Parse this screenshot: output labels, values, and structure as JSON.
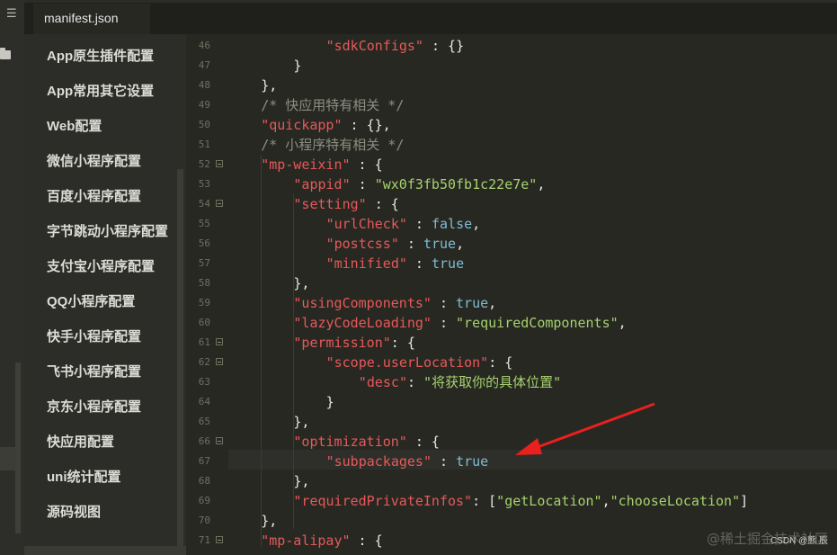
{
  "tab": {
    "label": "manifest.json"
  },
  "sidebar": {
    "items": [
      "App原生插件配置",
      "App常用其它设置",
      "Web配置",
      "微信小程序配置",
      "百度小程序配置",
      "字节跳动小程序配置",
      "支付宝小程序配置",
      "QQ小程序配置",
      "快手小程序配置",
      "飞书小程序配置",
      "京东小程序配置",
      "快应用配置",
      "uni统计配置",
      "源码视图"
    ]
  },
  "editor": {
    "line_numbers": [
      "46",
      "47",
      "48",
      "49",
      "50",
      "51",
      "52",
      "53",
      "54",
      "55",
      "56",
      "57",
      "58",
      "59",
      "60",
      "61",
      "62",
      "63",
      "64",
      "65",
      "66",
      "67",
      "68",
      "69",
      "70",
      "71"
    ],
    "lines": [
      [
        [
          "s",
          "\"sdkConfigs\""
        ],
        [
          "p",
          " : {}"
        ]
      ],
      [
        [
          "p",
          "}"
        ]
      ],
      [
        [
          "p",
          "},"
        ]
      ],
      [
        [
          "c",
          "/* 快应用特有相关 */"
        ]
      ],
      [
        [
          "s",
          "\"quickapp\""
        ],
        [
          "p",
          " : {},"
        ]
      ],
      [
        [
          "c",
          "/* 小程序特有相关 */"
        ]
      ],
      [
        [
          "s",
          "\"mp-weixin\""
        ],
        [
          "p",
          " : {"
        ]
      ],
      [
        [
          "s",
          "\"appid\""
        ],
        [
          "p",
          " : "
        ],
        [
          "t",
          "\"wx0f3fb50fb1c22e7e\""
        ],
        [
          "p",
          ","
        ]
      ],
      [
        [
          "s",
          "\"setting\""
        ],
        [
          "p",
          " : {"
        ]
      ],
      [
        [
          "s",
          "\"urlCheck\""
        ],
        [
          "p",
          " : "
        ],
        [
          "v",
          "false"
        ],
        [
          "p",
          ","
        ]
      ],
      [
        [
          "s",
          "\"postcss\""
        ],
        [
          "p",
          " : "
        ],
        [
          "v",
          "true"
        ],
        [
          "p",
          ","
        ]
      ],
      [
        [
          "s",
          "\"minified\""
        ],
        [
          "p",
          " : "
        ],
        [
          "v",
          "true"
        ]
      ],
      [
        [
          "p",
          "},"
        ]
      ],
      [
        [
          "s",
          "\"usingComponents\""
        ],
        [
          "p",
          " : "
        ],
        [
          "v",
          "true"
        ],
        [
          "p",
          ","
        ]
      ],
      [
        [
          "s",
          "\"lazyCodeLoading\""
        ],
        [
          "p",
          " : "
        ],
        [
          "t",
          "\"requiredComponents\""
        ],
        [
          "p",
          ","
        ]
      ],
      [
        [
          "s",
          "\"permission\""
        ],
        [
          "p",
          ": {"
        ]
      ],
      [
        [
          "s",
          "\"scope.userLocation\""
        ],
        [
          "p",
          ": {"
        ]
      ],
      [
        [
          "s",
          "\"desc\""
        ],
        [
          "p",
          ": "
        ],
        [
          "t",
          "\"将获取你的具体位置\""
        ]
      ],
      [
        [
          "p",
          "}"
        ]
      ],
      [
        [
          "p",
          "},"
        ]
      ],
      [
        [
          "s",
          "\"optimization\""
        ],
        [
          "p",
          " : {"
        ]
      ],
      [
        [
          "s",
          "\"subpackages\""
        ],
        [
          "p",
          " : "
        ],
        [
          "v",
          "true"
        ]
      ],
      [
        [
          "p",
          "},"
        ]
      ],
      [
        [
          "s",
          "\"requiredPrivateInfos\""
        ],
        [
          "p",
          ": ["
        ],
        [
          "t",
          "\"getLocation\""
        ],
        [
          "p",
          ","
        ],
        [
          "t",
          "\"chooseLocation\""
        ],
        [
          "p",
          "]"
        ]
      ],
      [
        [
          "p",
          "},"
        ]
      ],
      [
        [
          "s",
          "\"mp-alipay\""
        ],
        [
          "p",
          " : {"
        ]
      ]
    ]
  },
  "watermark": {
    "text": "@稀土掘金技术社区",
    "small": "CSDN @熊 辰"
  },
  "colors": {
    "arrow": "#e8201e",
    "string": "#e6595a",
    "boolean": "#7fbcd2",
    "text_value": "#a6d26e",
    "comment": "#8d8e80"
  }
}
